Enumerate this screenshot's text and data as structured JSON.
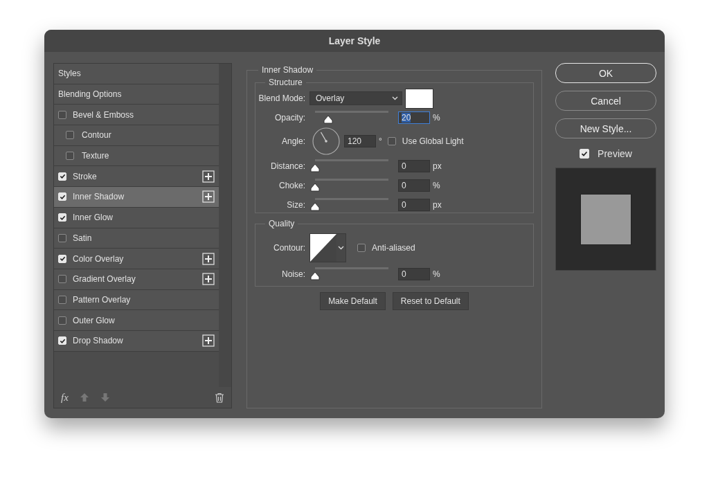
{
  "window": {
    "title": "Layer Style"
  },
  "styles_list": {
    "items": [
      {
        "kind": "header",
        "label": "Styles",
        "selected": false
      },
      {
        "kind": "header",
        "label": "Blending Options",
        "selected": false
      },
      {
        "kind": "effect",
        "label": "Bevel & Emboss",
        "checked": false,
        "addable": false,
        "selected": false,
        "children": [
          {
            "kind": "effect",
            "label": "Contour",
            "checked": false,
            "addable": false,
            "selected": false
          },
          {
            "kind": "effect",
            "label": "Texture",
            "checked": false,
            "addable": false,
            "selected": false
          }
        ]
      },
      {
        "kind": "effect",
        "label": "Stroke",
        "checked": true,
        "addable": true,
        "selected": false
      },
      {
        "kind": "effect",
        "label": "Inner Shadow",
        "checked": true,
        "addable": true,
        "selected": true
      },
      {
        "kind": "effect",
        "label": "Inner Glow",
        "checked": true,
        "addable": false,
        "selected": false
      },
      {
        "kind": "effect",
        "label": "Satin",
        "checked": false,
        "addable": false,
        "selected": false
      },
      {
        "kind": "effect",
        "label": "Color Overlay",
        "checked": true,
        "addable": true,
        "selected": false
      },
      {
        "kind": "effect",
        "label": "Gradient Overlay",
        "checked": false,
        "addable": true,
        "selected": false
      },
      {
        "kind": "effect",
        "label": "Pattern Overlay",
        "checked": false,
        "addable": false,
        "selected": false
      },
      {
        "kind": "effect",
        "label": "Outer Glow",
        "checked": false,
        "addable": false,
        "selected": false
      },
      {
        "kind": "effect",
        "label": "Drop Shadow",
        "checked": true,
        "addable": true,
        "selected": false
      }
    ],
    "fx_label": "fx"
  },
  "panel": {
    "title": "Inner Shadow",
    "structure": {
      "title": "Structure",
      "blend_mode": {
        "label": "Blend Mode:",
        "value": "Overlay"
      },
      "rows": [
        {
          "kind": "slider",
          "label": "Opacity:",
          "level": 0.18,
          "value": "20",
          "unit": "%",
          "focused": true
        },
        {
          "kind": "angle",
          "label": "Angle:",
          "value": "120",
          "unit": "°",
          "global_light": {
            "label": "Use Global Light",
            "checked": false
          }
        },
        {
          "kind": "slider",
          "label": "Distance:",
          "level": 0,
          "value": "0",
          "unit": "px",
          "focused": false
        },
        {
          "kind": "slider",
          "label": "Choke:",
          "level": 0,
          "value": "0",
          "unit": "%",
          "focused": false
        },
        {
          "kind": "slider",
          "label": "Size:",
          "level": 0,
          "value": "0",
          "unit": "px",
          "focused": false
        }
      ]
    },
    "quality": {
      "title": "Quality",
      "contour_label": "Contour:",
      "anti_aliased": {
        "label": "Anti-aliased",
        "checked": false
      },
      "noise": {
        "label": "Noise:",
        "level": 0,
        "value": "0",
        "unit": "%"
      }
    },
    "buttons": [
      "Make Default",
      "Reset to Default"
    ]
  },
  "actions": [
    {
      "label": "OK",
      "default": true
    },
    {
      "label": "Cancel",
      "default": false
    },
    {
      "label": "New Style...",
      "default": false
    }
  ],
  "preview": {
    "label": "Preview",
    "checked": true
  }
}
